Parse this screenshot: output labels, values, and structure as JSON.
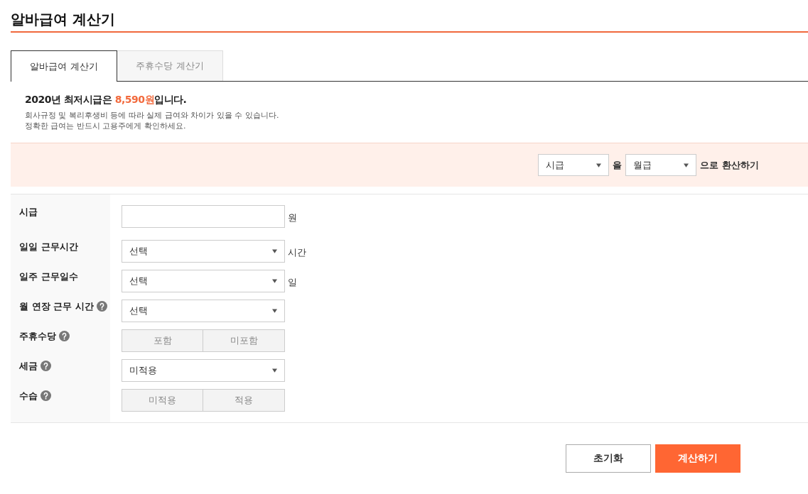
{
  "page_title": "알바급여 계산기",
  "tabs": [
    {
      "label": "알바급여 계산기",
      "selected": true
    },
    {
      "label": "주휴수당 계산기",
      "selected": false
    }
  ],
  "notice": {
    "headline": {
      "before": "2020년 최저시급은 ",
      "highlight": "8,590원",
      "after": "입니다."
    },
    "notes": [
      "회사규정 및 복리후생비 등에 따라 실제 급여와 차이가 있을 수 있습니다.",
      "정확한 급여는 반드시 고용주에게 확인하세요."
    ]
  },
  "converter": {
    "from_select": "시급",
    "joiner": "을",
    "to_select": "월급",
    "suffix": "으로 환산하기"
  },
  "fields": [
    {
      "label": "시급",
      "help": false,
      "kind": "input",
      "unit": "원"
    },
    {
      "label": "일일 근무시간",
      "help": false,
      "kind": "select",
      "value": "선택",
      "unit": "시간"
    },
    {
      "label": "일주 근무일수",
      "help": false,
      "kind": "select",
      "value": "선택",
      "unit": "일"
    },
    {
      "label": "월 연장 근무 시간",
      "help": true,
      "kind": "select",
      "value": "선택"
    },
    {
      "label": "주휴수당",
      "help": true,
      "kind": "toggle",
      "options": [
        {
          "label": "포함",
          "selected": false
        },
        {
          "label": "미포함",
          "selected": false
        }
      ]
    },
    {
      "label": "세금",
      "help": true,
      "kind": "select",
      "value": "미적용"
    },
    {
      "label": "수습",
      "help": true,
      "kind": "toggle",
      "options": [
        {
          "label": "미적용",
          "selected": false
        },
        {
          "label": "적용",
          "selected": false
        }
      ]
    }
  ],
  "buttons": [
    {
      "label": "초기화",
      "kind": "secondary"
    },
    {
      "label": "계산하기",
      "kind": "primary"
    }
  ]
}
